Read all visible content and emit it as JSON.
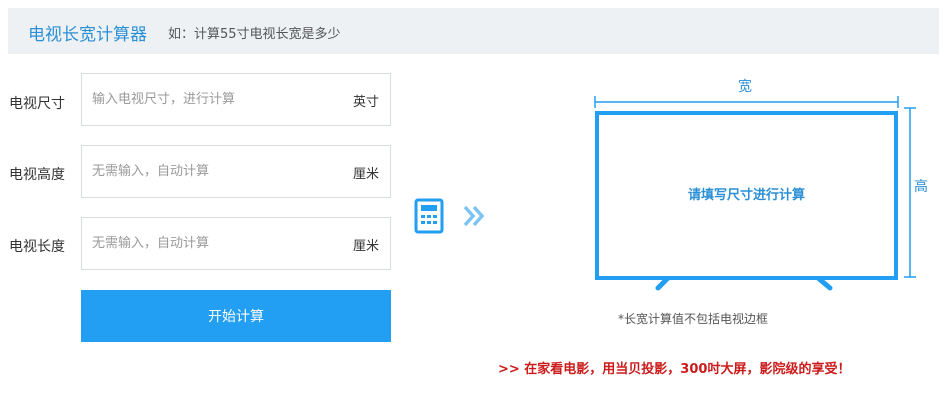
{
  "header": {
    "title": "电视长宽计算器",
    "hint": "如：计算55寸电视长宽是多少"
  },
  "form": {
    "size": {
      "label": "电视尺寸",
      "placeholder": "输入电视尺寸，进行计算",
      "unit": "英寸"
    },
    "height": {
      "label": "电视高度",
      "placeholder": "无需输入，自动计算",
      "unit": "厘米"
    },
    "length": {
      "label": "电视长度",
      "placeholder": "无需输入，自动计算",
      "unit": "厘米"
    },
    "submit_label": "开始计算"
  },
  "icons": {
    "calculator": "calculator-icon",
    "arrows": "double-chevron-right-icon"
  },
  "tv": {
    "width_label": "宽",
    "height_label": "高",
    "screen_message": "请填写尺寸进行计算",
    "note": "*长宽计算值不包括电视边框"
  },
  "promo": {
    "text": ">> 在家看电影，用当贝投影，300吋大屏，影院级的享受！"
  },
  "colors": {
    "accent": "#229ef2",
    "title_blue": "#2b8fd6",
    "promo_red": "#cc1b1b",
    "header_bg": "#edf1f4"
  }
}
